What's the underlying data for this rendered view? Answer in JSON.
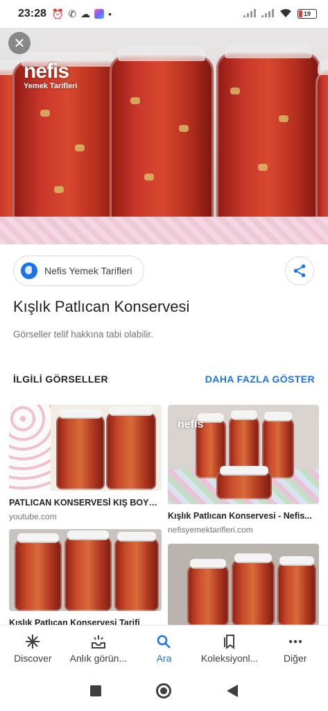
{
  "status_bar": {
    "time": "23:28",
    "battery": "19",
    "colors": {
      "battery_low": "#e53935"
    }
  },
  "hero": {
    "watermark_brand": "nefis",
    "watermark_sub": "Yemek Tarifleri"
  },
  "detail": {
    "source_name": "Nefis Yemek Tarifleri",
    "title": "Kışlık Patlıcan Konservesi",
    "copyright_note": "Görseller telif hakkına tabi olabilir."
  },
  "related": {
    "heading": "İLGİLİ GÖRSELLER",
    "more_label": "DAHA FAZLA GÖSTER",
    "items": [
      {
        "title": "PATLICAN KONSERVESİ KIŞ BOYU...",
        "source": "youtube.com"
      },
      {
        "title": "Kışlık Patlıcan Konservesi - Nefis...",
        "source": "nefisyemektarifleri.com"
      },
      {
        "title": "Kışlık Patlıcan Konservesi Tarifi",
        "source": ""
      },
      {
        "title": "",
        "source": ""
      }
    ]
  },
  "bottom_nav": {
    "items": [
      {
        "label": "Discover",
        "icon": "asterisk-icon"
      },
      {
        "label": "Anlık görün...",
        "icon": "updates-tray-icon"
      },
      {
        "label": "Ara",
        "icon": "search-icon"
      },
      {
        "label": "Koleksiyonl...",
        "icon": "collections-icon"
      },
      {
        "label": "Diğer",
        "icon": "more-dots-icon"
      }
    ],
    "active_index": 2,
    "colors": {
      "active": "#1a73e8"
    }
  },
  "system_nav": {
    "icons": [
      "recents-square-icon",
      "home-circle-icon",
      "back-triangle-icon"
    ]
  }
}
